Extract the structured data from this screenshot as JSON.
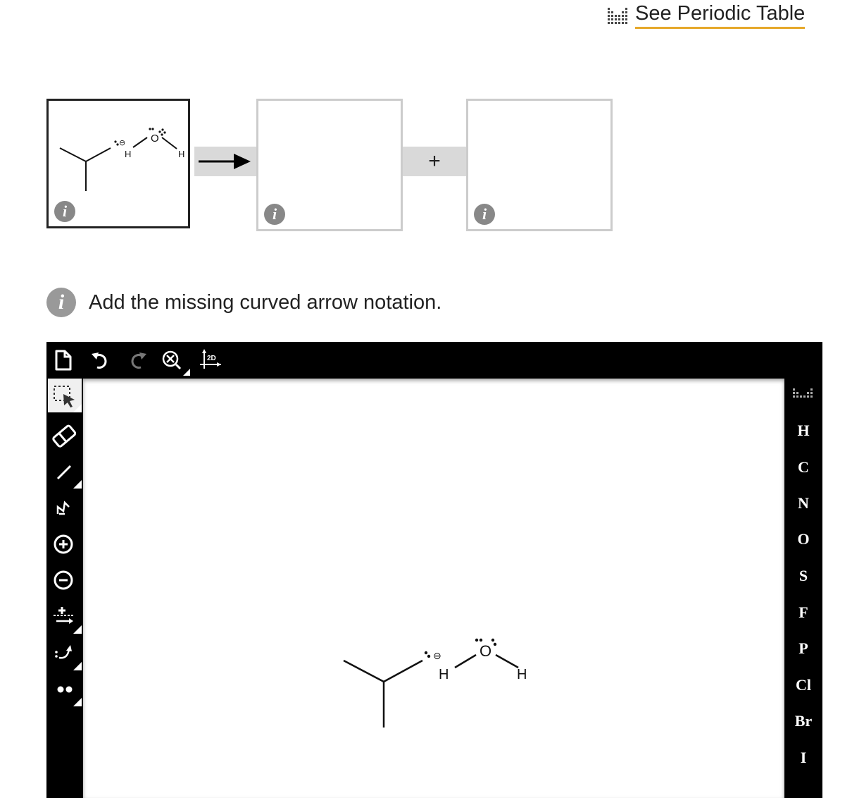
{
  "header": {
    "periodic_link": "See Periodic Table",
    "icon": "periodic-table-icon"
  },
  "reaction": {
    "arrow": "reaction-arrow",
    "plus": "+",
    "reactant_molecule": {
      "atoms": [
        "H",
        "O",
        "H"
      ],
      "charge": "⊖"
    }
  },
  "instruction": {
    "info_glyph": "i",
    "text": "Add the missing curved arrow notation."
  },
  "editor": {
    "top_toolbar": [
      "new-document-icon",
      "undo-icon",
      "redo-icon",
      "zoom-clear-icon",
      "2d-clean-icon"
    ],
    "clean_label": "2D",
    "left_toolbar": [
      "select-icon",
      "eraser-icon",
      "bond-icon",
      "chain-icon",
      "positive-charge-icon",
      "negative-charge-icon",
      "bond-arrow-icon",
      "curved-arrow-icon",
      "lone-pair-icon"
    ],
    "elements": [
      "H",
      "C",
      "N",
      "O",
      "S",
      "F",
      "P",
      "Cl",
      "Br",
      "I"
    ],
    "canvas_molecule": {
      "atoms": [
        "H",
        "O",
        "H"
      ],
      "charge": "⊖"
    }
  },
  "colors": {
    "accent_underline": "#e6a82a",
    "toolbar_bg": "#000000",
    "info_icon": "#888888"
  }
}
